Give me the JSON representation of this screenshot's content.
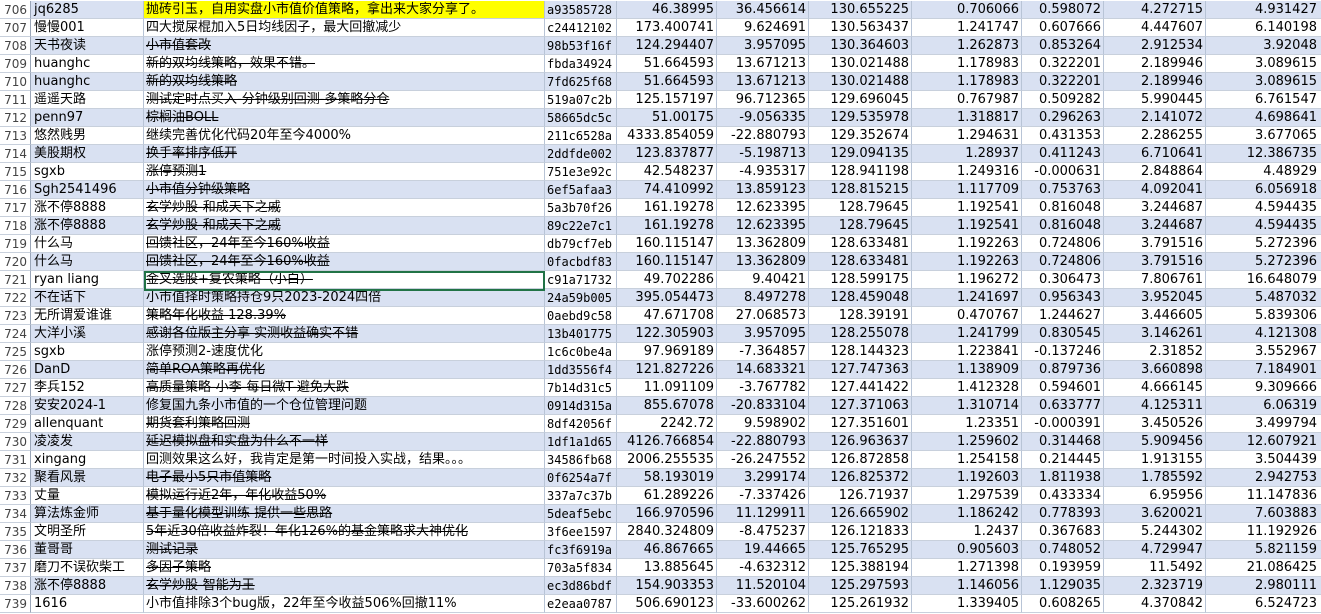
{
  "rows": [
    {
      "n": "706",
      "user": "jq6285",
      "title": "抛砖引玉，自用实盘小市值价值策略，拿出来大家分享了。",
      "id": "a93585728",
      "v1": "46.38995",
      "v2": "36.456614",
      "v3": "130.655225",
      "v4": "0.706066",
      "v5": "0.598072",
      "v6": "4.272715",
      "v7": "4.931427"
    },
    {
      "n": "707",
      "user": "慢慢001",
      "title": "四大搅屎棍加入5日均线因子，最大回撤减少",
      "id": "c24412102",
      "v1": "173.400741",
      "v2": "9.624691",
      "v3": "130.563437",
      "v4": "1.241747",
      "v5": "0.607666",
      "v6": "4.447607",
      "v7": "6.140198"
    },
    {
      "n": "708",
      "user": "天书夜读",
      "title": "小市值套改",
      "id": "98b53f16f",
      "v1": "124.294407",
      "v2": "3.957095",
      "v3": "130.364603",
      "v4": "1.262873",
      "v5": "0.853264",
      "v6": "2.912534",
      "v7": "3.92048"
    },
    {
      "n": "709",
      "user": "huanghc",
      "title": "新的双均线策略，效果不错。",
      "id": "fbda34924",
      "v1": "51.664593",
      "v2": "13.671213",
      "v3": "130.021488",
      "v4": "1.178983",
      "v5": "0.322201",
      "v6": "2.189946",
      "v7": "3.089615"
    },
    {
      "n": "710",
      "user": "huanghc",
      "title": "新的双均线策略",
      "id": "7fd625f68",
      "v1": "51.664593",
      "v2": "13.671213",
      "v3": "130.021488",
      "v4": "1.178983",
      "v5": "0.322201",
      "v6": "2.189946",
      "v7": "3.089615"
    },
    {
      "n": "711",
      "user": "遥遥天路",
      "title": "测试定时点买入-分钟级别回测-多策略分仓",
      "id": "519a07c2b",
      "v1": "125.157197",
      "v2": "96.712365",
      "v3": "129.696045",
      "v4": "0.767987",
      "v5": "0.509282",
      "v6": "5.990445",
      "v7": "6.761547"
    },
    {
      "n": "712",
      "user": "penn97",
      "title": "棕榈油BOLL",
      "id": "58665dc5c",
      "v1": "51.00175",
      "v2": "-9.056335",
      "v3": "129.535978",
      "v4": "1.318817",
      "v5": "0.296263",
      "v6": "2.141072",
      "v7": "4.698641"
    },
    {
      "n": "713",
      "user": "悠然贱男",
      "title": "继续完善优化代码20年至今4000%",
      "id": "211c6528a",
      "v1": "4333.854059",
      "v2": "-22.880793",
      "v3": "129.352674",
      "v4": "1.294631",
      "v5": "0.431353",
      "v6": "2.286255",
      "v7": "3.677065"
    },
    {
      "n": "714",
      "user": "美股期权",
      "title": "换手率排序低开",
      "id": "2ddfde002",
      "v1": "123.837877",
      "v2": "-5.198713",
      "v3": "129.094135",
      "v4": "1.28937",
      "v5": "0.411243",
      "v6": "6.710641",
      "v7": "12.386735"
    },
    {
      "n": "715",
      "user": "sgxb",
      "title": "涨停预测1",
      "id": "751e3e92c",
      "v1": "42.548237",
      "v2": "-4.935317",
      "v3": "128.941198",
      "v4": "1.249316",
      "v5": "-0.000631",
      "v6": "2.848864",
      "v7": "4.48929"
    },
    {
      "n": "716",
      "user": "Sgh2541496",
      "title": "小市值分钟级策略",
      "id": "6ef5afaa3",
      "v1": "74.410992",
      "v2": "13.859123",
      "v3": "128.815215",
      "v4": "1.117709",
      "v5": "0.753763",
      "v6": "4.092041",
      "v7": "6.056918"
    },
    {
      "n": "717",
      "user": "涨不停8888",
      "title": "玄学炒股-和成天下之戚",
      "id": "5a3b70f26",
      "v1": "161.19278",
      "v2": "12.623395",
      "v3": "128.79645",
      "v4": "1.192541",
      "v5": "0.816048",
      "v6": "3.244687",
      "v7": "4.594435"
    },
    {
      "n": "718",
      "user": "涨不停8888",
      "title": "玄学炒股-和成天下之戚",
      "id": "89c22e7c1",
      "v1": "161.19278",
      "v2": "12.623395",
      "v3": "128.79645",
      "v4": "1.192541",
      "v5": "0.816048",
      "v6": "3.244687",
      "v7": "4.594435"
    },
    {
      "n": "719",
      "user": "什么马",
      "title": "回馈社区，24年至今160%收益",
      "id": "db79cf7eb",
      "v1": "160.115147",
      "v2": "13.362809",
      "v3": "128.633481",
      "v4": "1.192263",
      "v5": "0.724806",
      "v6": "3.791516",
      "v7": "5.272396"
    },
    {
      "n": "720",
      "user": "什么马",
      "title": "回馈社区，24年至今160%收益",
      "id": "0facbdf83",
      "v1": "160.115147",
      "v2": "13.362809",
      "v3": "128.633481",
      "v4": "1.192263",
      "v5": "0.724806",
      "v6": "3.791516",
      "v7": "5.272396"
    },
    {
      "n": "721",
      "user": "ryan liang",
      "title": "金叉选股+复农策略（小白）",
      "id": "c91a71732",
      "v1": "49.702286",
      "v2": "9.40421",
      "v3": "128.599175",
      "v4": "1.196272",
      "v5": "0.306473",
      "v6": "7.806761",
      "v7": "16.648079"
    },
    {
      "n": "722",
      "user": "不在话下",
      "title": "小市值择时策略持仓9只2023-2024四倍",
      "id": "24a59b005",
      "v1": "395.054473",
      "v2": "8.497278",
      "v3": "128.459048",
      "v4": "1.241697",
      "v5": "0.956343",
      "v6": "3.952045",
      "v7": "5.487032"
    },
    {
      "n": "723",
      "user": "无所谓爱谁谁",
      "title": "策略年化收益 128.39%",
      "id": "0aebd9c58",
      "v1": "47.671708",
      "v2": "27.068573",
      "v3": "128.39191",
      "v4": "0.470767",
      "v5": "1.244627",
      "v6": "3.446605",
      "v7": "5.839306"
    },
    {
      "n": "724",
      "user": "大洋小溪",
      "title": "感谢各位版主分享 实测收益确实不错",
      "id": "13b401775",
      "v1": "122.305903",
      "v2": "3.957095",
      "v3": "128.255078",
      "v4": "1.241799",
      "v5": "0.830545",
      "v6": "3.146261",
      "v7": "4.121308"
    },
    {
      "n": "725",
      "user": "sgxb",
      "title": "涨停预测2-速度优化",
      "id": "1c6c0be4a",
      "v1": "97.969189",
      "v2": "-7.364857",
      "v3": "128.144323",
      "v4": "1.223841",
      "v5": "-0.137246",
      "v6": "2.31852",
      "v7": "3.552967"
    },
    {
      "n": "726",
      "user": "DanD",
      "title": "简单ROA策略再优化",
      "id": "1dd3556f4",
      "v1": "121.827226",
      "v2": "14.683321",
      "v3": "127.747363",
      "v4": "1.138909",
      "v5": "0.879736",
      "v6": "3.660898",
      "v7": "7.184901"
    },
    {
      "n": "727",
      "user": "李兵152",
      "title": "高质量策略-小李-每日微T-避免大跌",
      "id": "7b14d31c5",
      "v1": "11.091109",
      "v2": "-3.767782",
      "v3": "127.441422",
      "v4": "1.412328",
      "v5": "0.594601",
      "v6": "4.666145",
      "v7": "9.309666"
    },
    {
      "n": "728",
      "user": "安安2024-1",
      "title": "修复国九条小市值的一个仓位管理问题",
      "id": "0914d315a",
      "v1": "855.67078",
      "v2": "-20.833104",
      "v3": "127.371063",
      "v4": "1.310714",
      "v5": "0.633777",
      "v6": "4.125311",
      "v7": "6.06319"
    },
    {
      "n": "729",
      "user": "allenquant",
      "title": "期货套利策略回测",
      "id": "8df42056f",
      "v1": "2242.72",
      "v2": "9.598902",
      "v3": "127.351601",
      "v4": "1.23351",
      "v5": "-0.000391",
      "v6": "3.450526",
      "v7": "3.499794"
    },
    {
      "n": "730",
      "user": "凌凌发",
      "title": "延迟模拟盘和实盘为什么不一样",
      "id": "1df1a1d65",
      "v1": "4126.766854",
      "v2": "-22.880793",
      "v3": "126.963637",
      "v4": "1.259602",
      "v5": "0.314468",
      "v6": "5.909456",
      "v7": "12.607921"
    },
    {
      "n": "731",
      "user": "xingang",
      "title": "回测效果这么好，我肯定是第一时间投入实战，结果。。。",
      "id": "34586fb68",
      "v1": "2006.255535",
      "v2": "-26.247552",
      "v3": "126.872858",
      "v4": "1.254158",
      "v5": "0.214445",
      "v6": "1.913155",
      "v7": "3.504439"
    },
    {
      "n": "732",
      "user": "聚看风景",
      "title": "电子最小5只市值策略",
      "id": "0f6254a7f",
      "v1": "58.193019",
      "v2": "3.299174",
      "v3": "126.825372",
      "v4": "1.192603",
      "v5": "1.811938",
      "v6": "1.785592",
      "v7": "2.942753"
    },
    {
      "n": "733",
      "user": "丈量",
      "title": "模拟运行近2年，年化收益50%",
      "id": "337a7c37b",
      "v1": "61.289226",
      "v2": "-7.337426",
      "v3": "126.71937",
      "v4": "1.297539",
      "v5": "0.433334",
      "v6": "6.95956",
      "v7": "11.147836"
    },
    {
      "n": "734",
      "user": "算法炼金师",
      "title": "基于量化模型训练 提供一些思路",
      "id": "5deaf5ebc",
      "v1": "166.970596",
      "v2": "11.129911",
      "v3": "126.665902",
      "v4": "1.186242",
      "v5": "0.778393",
      "v6": "3.620021",
      "v7": "7.603883"
    },
    {
      "n": "735",
      "user": "文明圣所",
      "title": "5年近30倍收益炸裂！年化126%的基金策略求大神优化",
      "id": "3f6ee1597",
      "v1": "2840.324809",
      "v2": "-8.475237",
      "v3": "126.121833",
      "v4": "1.2437",
      "v5": "0.367683",
      "v6": "5.244302",
      "v7": "11.192926"
    },
    {
      "n": "736",
      "user": "董哥哥",
      "title": "测试记录",
      "id": "fc3f6919a",
      "v1": "46.867665",
      "v2": "19.44665",
      "v3": "125.765295",
      "v4": "0.905603",
      "v5": "0.748052",
      "v6": "4.729947",
      "v7": "5.821159"
    },
    {
      "n": "737",
      "user": "磨刀不误砍柴工",
      "title": "多因子策略",
      "id": "703a5f834",
      "v1": "13.885645",
      "v2": "-4.632312",
      "v3": "125.388194",
      "v4": "1.271398",
      "v5": "0.193959",
      "v6": "11.5492",
      "v7": "21.086425"
    },
    {
      "n": "738",
      "user": "涨不停8888",
      "title": "玄学炒股-智能为王",
      "id": "ec3d86bdf",
      "v1": "154.903353",
      "v2": "11.520104",
      "v3": "125.297593",
      "v4": "1.146056",
      "v5": "1.129035",
      "v6": "2.323719",
      "v7": "2.980111"
    },
    {
      "n": "739",
      "user": "1616",
      "title": "小市值排除3个bug版，22年至今收益506%回撤11%",
      "id": "e2eaa0787",
      "v1": "506.690123",
      "v2": "-33.600262",
      "v3": "125.261932",
      "v4": "1.339405",
      "v5": "0.608265",
      "v6": "4.370842",
      "v7": "6.524723"
    }
  ]
}
